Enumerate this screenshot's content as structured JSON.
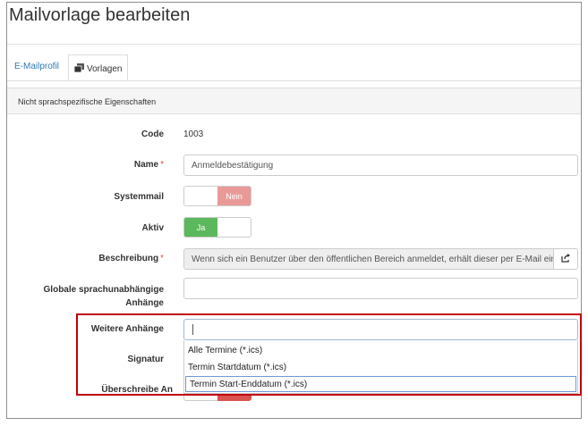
{
  "page": {
    "title": "Mailvorlage bearbeiten"
  },
  "tabs": [
    {
      "label": "E-Mailprofil",
      "active": false
    },
    {
      "label": "Vorlagen",
      "active": true,
      "icon": "copy-icon"
    }
  ],
  "panel": {
    "heading": "Nicht sprachspezifische Eigenschaften"
  },
  "form": {
    "code": {
      "label": "Code",
      "value": "1003"
    },
    "name": {
      "label": "Name",
      "required": "*",
      "value": "Anmeldebestätigung"
    },
    "systemmail": {
      "label": "Systemmail",
      "state": "Nein"
    },
    "aktiv": {
      "label": "Aktiv",
      "state": "Ja"
    },
    "beschreibung": {
      "label": "Beschreibung",
      "required": "*",
      "value": "Wenn sich ein Benutzer über den öffentlichen Bereich anmeldet, erhält dieser per E-Mail eine",
      "button_icon": "share-icon"
    },
    "globale": {
      "label": "Globale sprachunabhängige Anhänge",
      "value": ""
    },
    "weitere": {
      "label": "Weitere Anhänge",
      "value": "",
      "options": [
        "Alle Termine (*.ics)",
        "Termin Startdatum (*.ics)",
        "Termin Start-Enddatum (*.ics)"
      ],
      "selected_index": 2
    },
    "signatur": {
      "label": "Signatur"
    },
    "ueberschreibe": {
      "label": "Überschreibe An"
    }
  },
  "colors": {
    "accent": "#337ab7",
    "annotation": "#c0000f",
    "on": "#5cb85c",
    "off": "#d9534f"
  }
}
